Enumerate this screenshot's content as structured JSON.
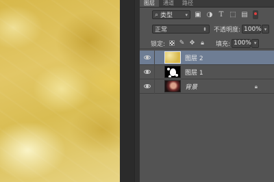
{
  "panel": {
    "tabs": [
      {
        "label": "图层",
        "active": true
      },
      {
        "label": "通道",
        "active": false
      },
      {
        "label": "路径",
        "active": false
      }
    ],
    "filter": {
      "icon": "search-icon",
      "selected": "类型",
      "icons": [
        "image-icon",
        "adjustment-icon",
        "text-icon",
        "shape-icon",
        "smart-object-icon"
      ]
    },
    "blend": {
      "mode": "正常",
      "opacity_label": "不透明度:",
      "opacity_value": "100%"
    },
    "lock": {
      "label": "锁定:",
      "icons": [
        "lock-transparent-icon",
        "lock-image-icon",
        "lock-position-icon",
        "lock-all-icon"
      ],
      "fill_label": "填充:",
      "fill_value": "100%"
    },
    "layers": [
      {
        "name": "图层 2",
        "visible": true,
        "selected": true,
        "thumbnail": "gold-texture"
      },
      {
        "name": "图层 1",
        "visible": true,
        "selected": false,
        "thumbnail": "mask"
      },
      {
        "name": "背景",
        "visible": true,
        "selected": false,
        "thumbnail": "portrait",
        "locked": true
      }
    ]
  },
  "colors": {
    "panel_bg": "#535353",
    "selected_layer": "#6e7d94",
    "canvas_gold": "#d9bd52"
  }
}
